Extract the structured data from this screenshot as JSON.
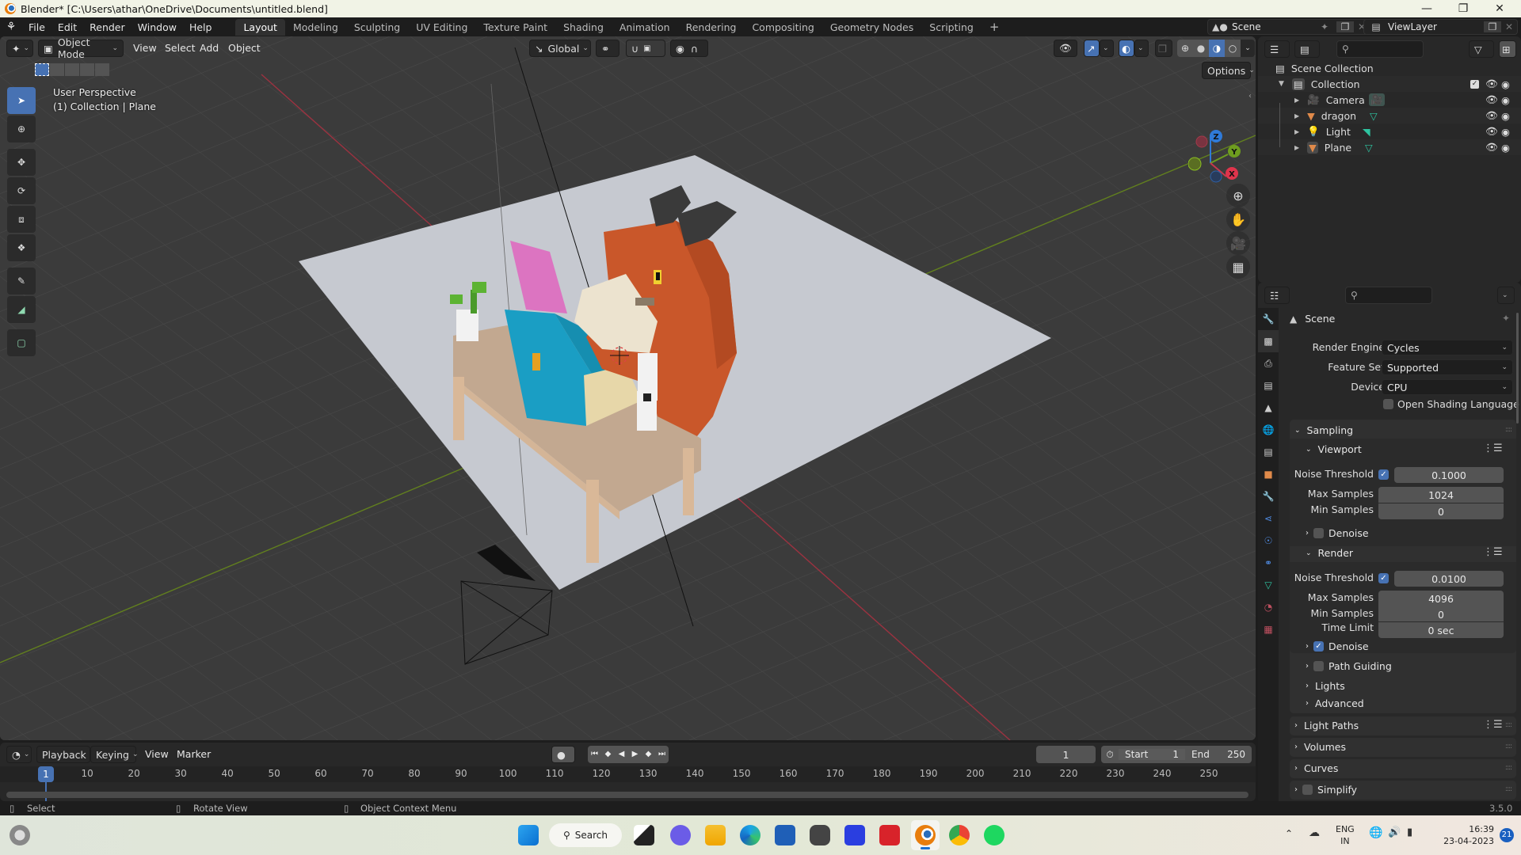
{
  "window": {
    "title": "Blender* [C:\\Users\\athar\\OneDrive\\Documents\\untitled.blend]",
    "controls": [
      "minimize",
      "maximize",
      "close"
    ]
  },
  "menubar": {
    "menus": [
      "File",
      "Edit",
      "Render",
      "Window",
      "Help"
    ],
    "workspaces": [
      "Layout",
      "Modeling",
      "Sculpting",
      "UV Editing",
      "Texture Paint",
      "Shading",
      "Animation",
      "Rendering",
      "Compositing",
      "Geometry Nodes",
      "Scripting"
    ],
    "active_workspace": "Layout",
    "add_workspace": "+",
    "scene_name": "Scene",
    "view_layer": "ViewLayer"
  },
  "viewport": {
    "mode": "Object Mode",
    "menus": [
      "View",
      "Select",
      "Add",
      "Object"
    ],
    "orientation": "Global",
    "options_label": "Options",
    "overlay_line1": "User Perspective",
    "overlay_line2": "(1) Collection | Plane",
    "gizmo_axes": {
      "x": "X",
      "y": "Y",
      "z": "Z"
    },
    "colors": {
      "x_axis": "#c8384e",
      "y_axis": "#6e9d1f",
      "z_axis": "#2f7ad8",
      "accent": "#4772b3"
    }
  },
  "outliner": {
    "root": "Scene Collection",
    "collection": "Collection",
    "items": [
      {
        "name": "Camera",
        "type": "camera"
      },
      {
        "name": "dragon",
        "type": "mesh"
      },
      {
        "name": "Light",
        "type": "light"
      },
      {
        "name": "Plane",
        "type": "mesh"
      }
    ]
  },
  "properties": {
    "context": "Scene",
    "render_engine_label": "Render Engine",
    "render_engine": "Cycles",
    "feature_set_label": "Feature Set",
    "feature_set": "Supported",
    "device_label": "Device",
    "device": "CPU",
    "osl_label": "Open Shading Language",
    "osl_checked": false,
    "sampling": {
      "title": "Sampling",
      "viewport": {
        "title": "Viewport",
        "noise_threshold_label": "Noise Threshold",
        "noise_threshold_enabled": true,
        "noise_threshold": "0.1000",
        "max_samples_label": "Max Samples",
        "max_samples": "1024",
        "min_samples_label": "Min Samples",
        "min_samples": "0",
        "denoise_label": "Denoise",
        "denoise": false
      },
      "render": {
        "title": "Render",
        "noise_threshold_label": "Noise Threshold",
        "noise_threshold_enabled": true,
        "noise_threshold": "0.0100",
        "max_samples_label": "Max Samples",
        "max_samples": "4096",
        "min_samples_label": "Min Samples",
        "min_samples": "0",
        "time_limit_label": "Time Limit",
        "time_limit": "0 sec",
        "denoise_label": "Denoise",
        "denoise": true
      },
      "path_guiding_label": "Path Guiding",
      "path_guiding": false,
      "lights_label": "Lights",
      "advanced_label": "Advanced"
    },
    "panels": [
      "Light Paths",
      "Volumes",
      "Curves",
      "Simplify"
    ]
  },
  "timeline": {
    "menus": [
      "Playback",
      "Keying",
      "View",
      "Marker"
    ],
    "current_frame": "1",
    "start_label": "Start",
    "start": "1",
    "end_label": "End",
    "end": "250",
    "ticks": [
      "10",
      "20",
      "30",
      "40",
      "50",
      "60",
      "70",
      "80",
      "90",
      "100",
      "110",
      "120",
      "130",
      "140",
      "150",
      "160",
      "170",
      "180",
      "190",
      "200",
      "210",
      "220",
      "230",
      "240",
      "250"
    ],
    "playhead": "1"
  },
  "statusbar": {
    "hints": [
      "Select",
      "Rotate View",
      "Object Context Menu"
    ],
    "version": "3.5.0"
  },
  "taskbar": {
    "search_label": "Search",
    "lang_line1": "ENG",
    "lang_line2": "IN",
    "time": "16:39",
    "date": "23-04-2023",
    "notifications": "21"
  }
}
